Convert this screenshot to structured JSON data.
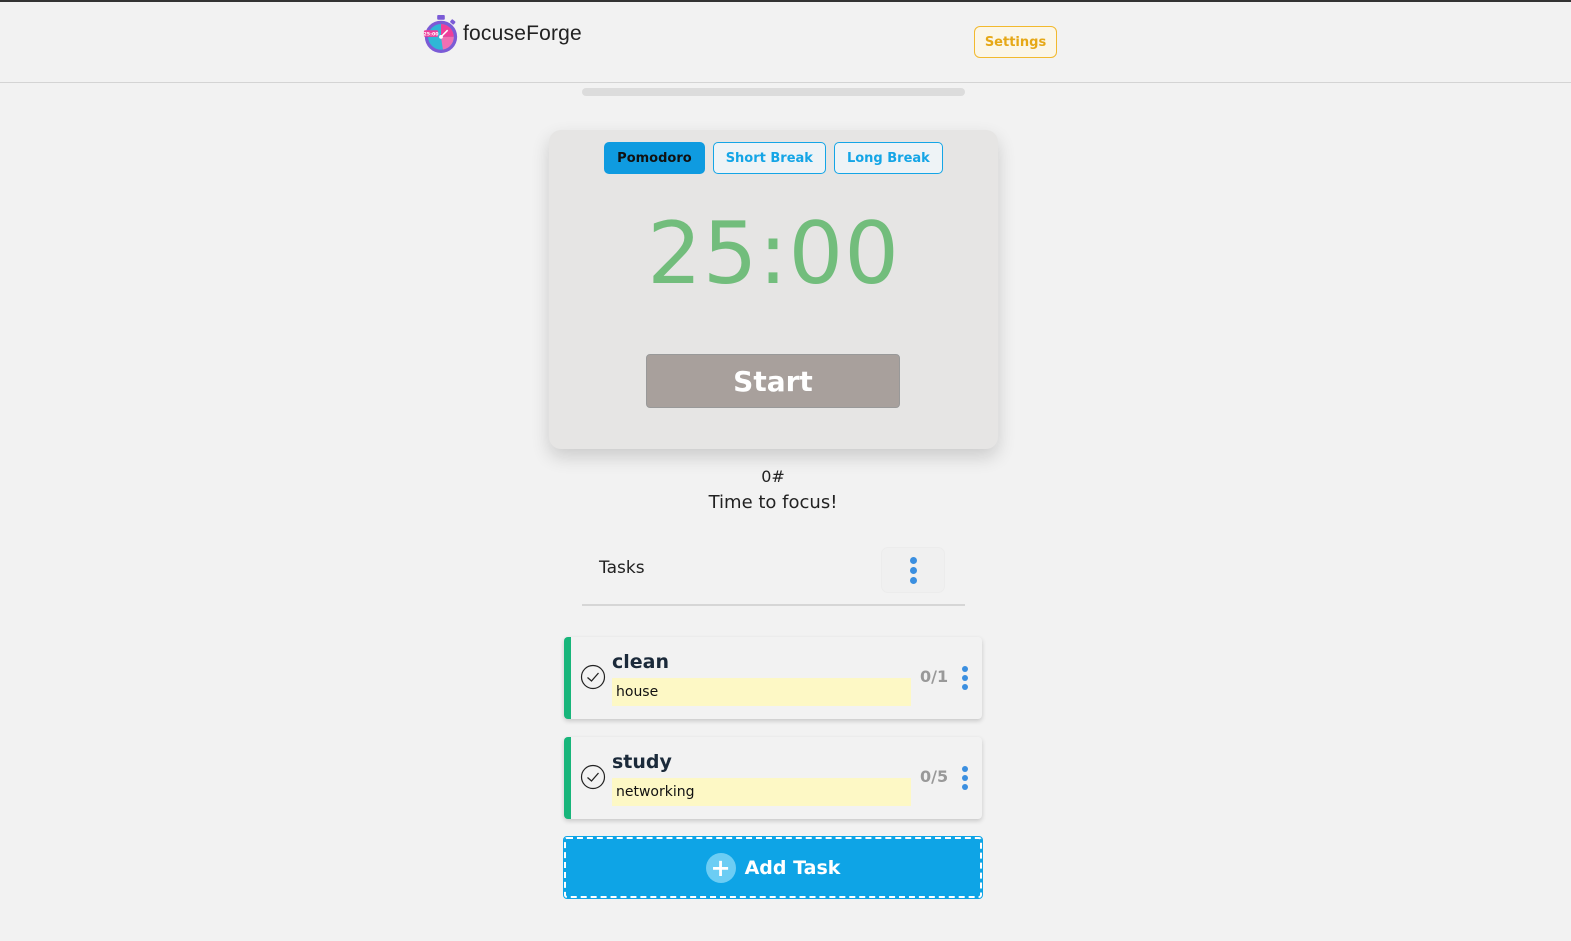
{
  "header": {
    "brand_name": "focuseForge",
    "logo_icon": "stopwatch-logo-icon",
    "settings_label": "Settings"
  },
  "progress": {
    "value_percent": 0
  },
  "timer": {
    "modes": [
      {
        "label": "Pomodoro",
        "active": true
      },
      {
        "label": "Short Break",
        "active": false
      },
      {
        "label": "Long Break",
        "active": false
      }
    ],
    "time": "25:00",
    "start_label": "Start",
    "time_color": "#72bd7c"
  },
  "session": {
    "count": "0#",
    "status": "Time to focus!"
  },
  "tasks": {
    "title": "Tasks",
    "menu_icon": "kebab-menu-icon",
    "items": [
      {
        "name": "clean",
        "note": "house",
        "progress": "0/1"
      },
      {
        "name": "study",
        "note": "networking",
        "progress": "0/5"
      }
    ],
    "add_label": "Add Task"
  },
  "colors": {
    "accent": "#0ea4e6",
    "settings": "#e6a817",
    "task_bar": "#17b57a",
    "note_bg": "#fdf8c5"
  }
}
